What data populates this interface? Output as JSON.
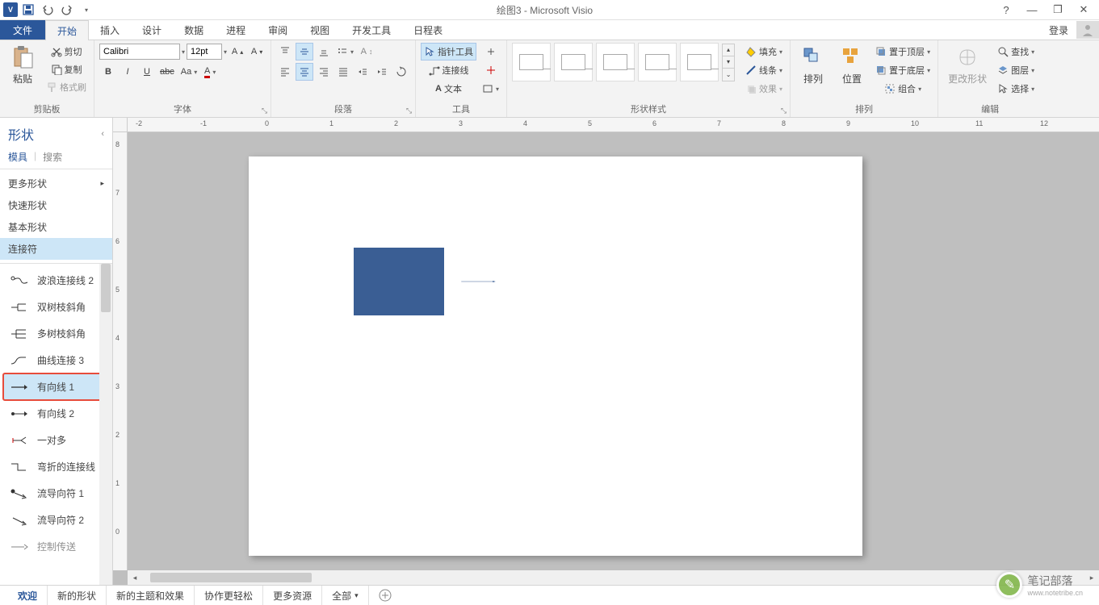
{
  "title": "绘图3 - Microsoft Visio",
  "qat": {
    "save": "保存",
    "undo": "撤销",
    "redo": "重做"
  },
  "window": {
    "help": "?",
    "min": "—",
    "restore": "❐",
    "close": "✕"
  },
  "tabs": {
    "file": "文件",
    "home": "开始",
    "insert": "插入",
    "design": "设计",
    "data": "数据",
    "process": "进程",
    "review": "审阅",
    "view": "视图",
    "developer": "开发工具",
    "schedule": "日程表",
    "login": "登录"
  },
  "ribbon": {
    "clipboard": {
      "label": "剪贴板",
      "paste": "粘贴",
      "cut": "剪切",
      "copy": "复制",
      "formatpainter": "格式刷"
    },
    "font": {
      "label": "字体",
      "name": "Calibri",
      "size": "12pt"
    },
    "paragraph": {
      "label": "段落"
    },
    "tools": {
      "label": "工具",
      "pointer": "指针工具",
      "connector": "连接线",
      "text": "文本"
    },
    "styles": {
      "label": "形状样式",
      "fill": "填充",
      "line": "线条",
      "effects": "效果"
    },
    "arrange": {
      "label": "排列",
      "arrange_btn": "排列",
      "position": "位置",
      "front": "置于顶层",
      "back": "置于底层",
      "group": "组合"
    },
    "edit": {
      "label": "编辑",
      "change": "更改形状",
      "find": "查找",
      "layers": "图层",
      "select": "选择"
    }
  },
  "shapes": {
    "title": "形状",
    "tab_stencil": "模具",
    "tab_search": "搜索",
    "more": "更多形状",
    "quick": "快速形状",
    "basic": "基本形状",
    "connectors": "连接符",
    "items": [
      "波浪连接线 2",
      "双树枝斜角",
      "多树枝斜角",
      "曲线连接 3",
      "有向线 1",
      "有向线 2",
      "一对多",
      "弯折的连接线",
      "流导向符 1",
      "流导向符 2",
      "控制传送"
    ]
  },
  "bottom": {
    "welcome": "欢迎",
    "newshapes": "新的形状",
    "newthemes": "新的主题和效果",
    "collab": "协作更轻松",
    "moreres": "更多资源",
    "all": "全部"
  },
  "watermark": {
    "text": "笔记部落",
    "url": "www.notetribe.cn"
  }
}
